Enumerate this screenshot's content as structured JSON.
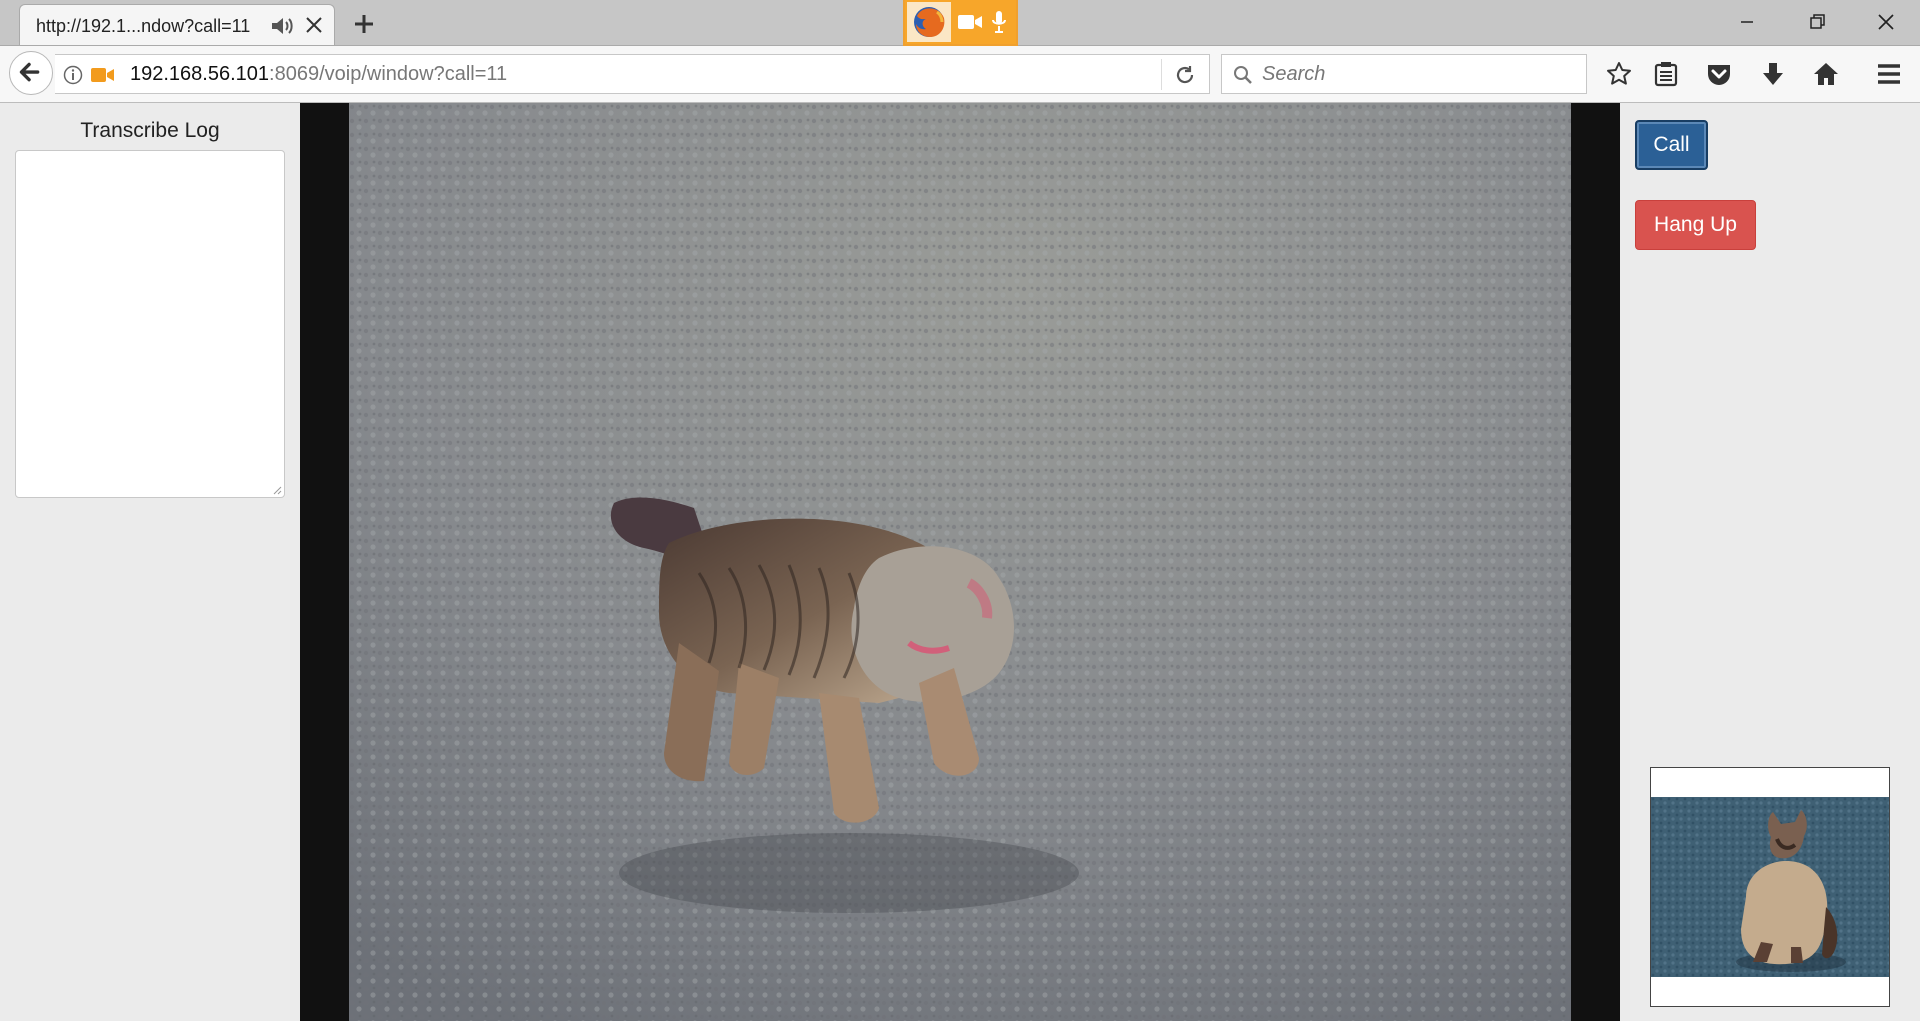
{
  "browser": {
    "tab": {
      "title": "http://192.1...ndow?call=11"
    },
    "url": {
      "host": "192.168.56.101",
      "rest": ":8069/voip/window?call=11"
    },
    "search": {
      "placeholder": "Search"
    },
    "icons": {
      "back": "back-arrow-icon",
      "info": "info-icon",
      "camera": "camera-icon",
      "microphone": "microphone-icon",
      "reload": "reload-icon",
      "bookmark": "star-icon",
      "reading_list": "clipboard-icon",
      "pocket": "pocket-icon",
      "download": "download-icon",
      "home": "home-icon",
      "menu": "hamburger-menu-icon"
    },
    "sharing_indicator_color": "#f7a62a"
  },
  "page": {
    "transcribe_log": {
      "title": "Transcribe Log",
      "value": ""
    },
    "buttons": {
      "call": "Call",
      "hang_up": "Hang Up"
    },
    "colors": {
      "call": "#2b6096",
      "hang_up": "#d9534f",
      "video_bg": "#111111"
    }
  }
}
